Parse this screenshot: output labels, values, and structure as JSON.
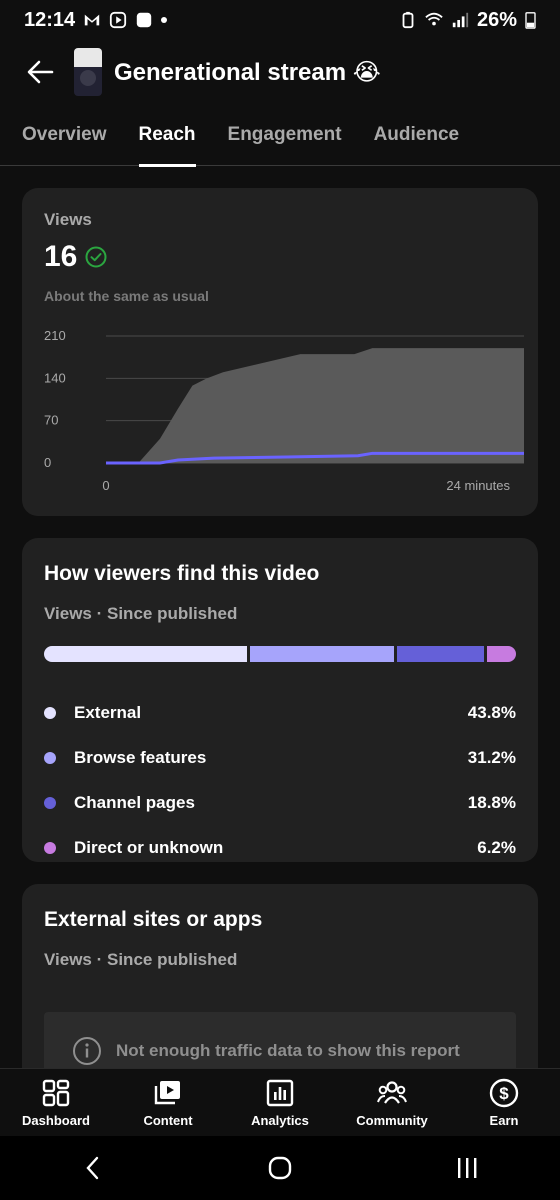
{
  "status_bar": {
    "time": "12:14",
    "battery": "26%"
  },
  "header": {
    "title": "Generational stream 😭"
  },
  "tabs": [
    {
      "label": "Overview",
      "active": false
    },
    {
      "label": "Reach",
      "active": true
    },
    {
      "label": "Engagement",
      "active": false
    },
    {
      "label": "Audience",
      "active": false
    }
  ],
  "views_card": {
    "label": "Views",
    "value": "16",
    "note": "About the same as usual"
  },
  "chart_data": {
    "type": "area",
    "x_start_label": "0",
    "x_end_label": "24 minutes",
    "y_ticks": [
      "210",
      "140",
      "70",
      "0"
    ],
    "ylim": [
      0,
      210
    ],
    "series": [
      {
        "name": "",
        "color": "#5a5a5a",
        "x": [
          0,
          1.8,
          3,
          4,
          4.8,
          5.6,
          6.5,
          10.8,
          13.8,
          14.8,
          24
        ],
        "values": [
          0,
          0,
          40,
          90,
          128,
          140,
          150,
          180,
          180,
          190,
          190
        ]
      },
      {
        "name": "",
        "color": "#6a63ff",
        "x": [
          0,
          3,
          4,
          6,
          10,
          14,
          14.8,
          24
        ],
        "values": [
          0,
          0,
          5,
          8,
          10,
          12,
          16,
          16
        ]
      }
    ],
    "grid": true
  },
  "traffic_card": {
    "title": "How viewers find this video",
    "subtitle": "Views · Since published",
    "sources": [
      {
        "label": "External",
        "value": "43.8%",
        "share": 43.8,
        "color": "#e4e3ff"
      },
      {
        "label": "Browse features",
        "value": "31.2%",
        "share": 31.2,
        "color": "#a6a4fb"
      },
      {
        "label": "Channel pages",
        "value": "18.8%",
        "share": 18.8,
        "color": "#6560d8"
      },
      {
        "label": "Direct or unknown",
        "value": "6.2%",
        "share": 6.2,
        "color": "#c77be0"
      }
    ]
  },
  "external_card": {
    "title": "External sites or apps",
    "subtitle": "Views · Since published",
    "empty_message": "Not enough traffic data to show this report"
  },
  "bottom_nav": [
    {
      "label": "Dashboard",
      "icon": "dashboard-icon"
    },
    {
      "label": "Content",
      "icon": "content-icon"
    },
    {
      "label": "Analytics",
      "icon": "analytics-icon"
    },
    {
      "label": "Community",
      "icon": "community-icon"
    },
    {
      "label": "Earn",
      "icon": "earn-icon"
    }
  ]
}
